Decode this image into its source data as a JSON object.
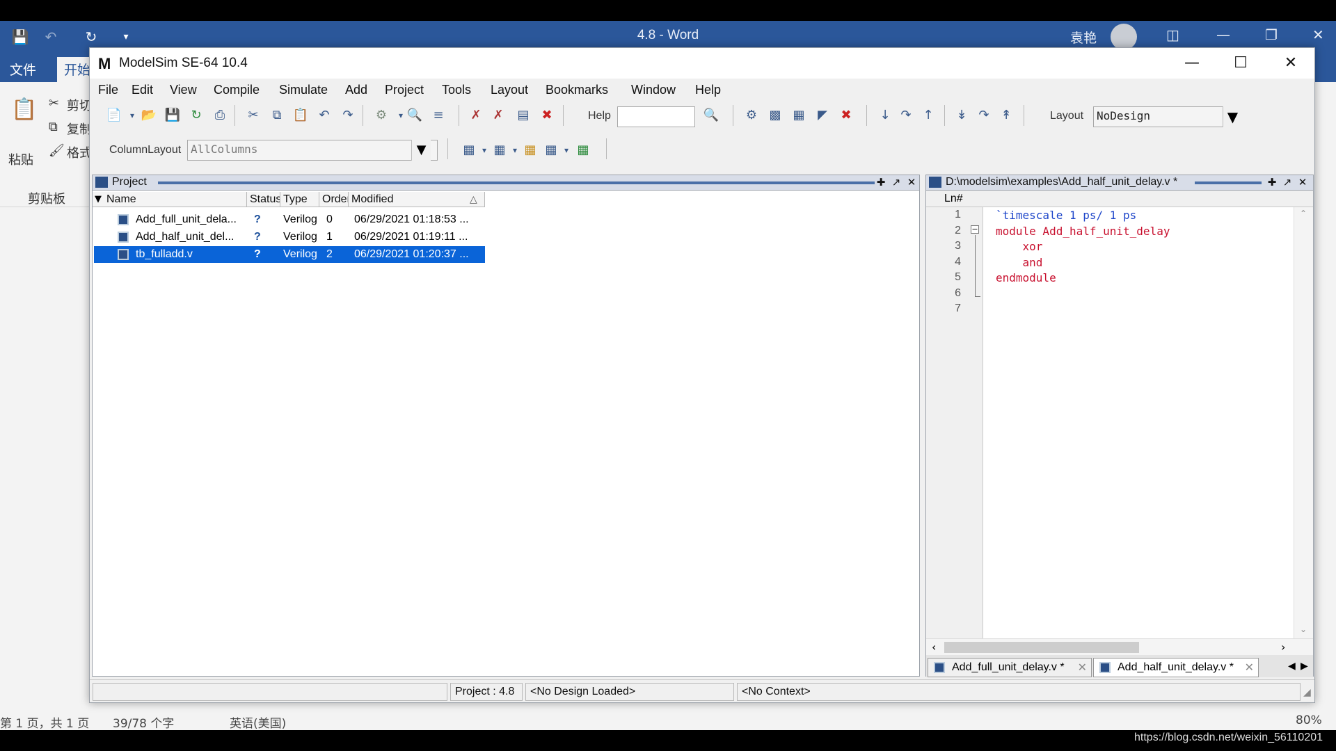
{
  "word": {
    "title": "4.8  -  Word",
    "user": "袁艳",
    "tabs": [
      "文件",
      "开始"
    ],
    "ribbon": {
      "paste": "粘贴",
      "cut": "剪切",
      "copy": "复制",
      "format": "格式",
      "clipboard": "剪贴板"
    },
    "status": {
      "page": "第 1 页，共 1 页",
      "words": "39/78 个字",
      "lang": "英语(美国)",
      "zoom": "80%"
    }
  },
  "watermark": "https://blog.csdn.net/weixin_56110201",
  "modelsim": {
    "title": "ModelSim SE-64 10.4",
    "menu": [
      "File",
      "Edit",
      "View",
      "Compile",
      "Simulate",
      "Add",
      "Project",
      "Tools",
      "Layout",
      "Bookmarks",
      "Window",
      "Help"
    ],
    "toolbar": {
      "help_label": "Help",
      "help_value": "",
      "layout_label": "Layout",
      "layout_value": "NoDesign",
      "columnlayout_label": "ColumnLayout",
      "columnlayout_value": "AllColumns"
    },
    "project": {
      "title": "Project",
      "columns": [
        "Name",
        "Status",
        "Type",
        "Order",
        "Modified"
      ],
      "rows": [
        {
          "name": "Add_full_unit_dela...",
          "status": "?",
          "type": "Verilog",
          "order": "0",
          "modified": "06/29/2021 01:18:53 ...",
          "selected": false
        },
        {
          "name": "Add_half_unit_del...",
          "status": "?",
          "type": "Verilog",
          "order": "1",
          "modified": "06/29/2021 01:19:11 ...",
          "selected": false
        },
        {
          "name": "tb_fulladd.v",
          "status": "?",
          "type": "Verilog",
          "order": "2",
          "modified": "06/29/2021 01:20:37 ...",
          "selected": true
        }
      ]
    },
    "editor": {
      "title": "D:\\modelsim\\examples\\Add_half_unit_delay.v *",
      "gutter_header": "Ln#",
      "lines": [
        {
          "n": "1",
          "text": "`timescale 1 ps/ 1 ps"
        },
        {
          "n": "2",
          "text": "module Add_half_unit_delay"
        },
        {
          "n": "3",
          "text": "    xor"
        },
        {
          "n": "4",
          "text": "    and"
        },
        {
          "n": "5",
          "text": "endmodule"
        },
        {
          "n": "6",
          "text": ""
        },
        {
          "n": "7",
          "text": ""
        }
      ],
      "tabs": [
        "Add_full_unit_delay.v *",
        "Add_half_unit_delay.v *"
      ]
    },
    "status": {
      "project": "Project : 4.8",
      "design": "<No Design Loaded>",
      "context": "<No Context>"
    }
  }
}
